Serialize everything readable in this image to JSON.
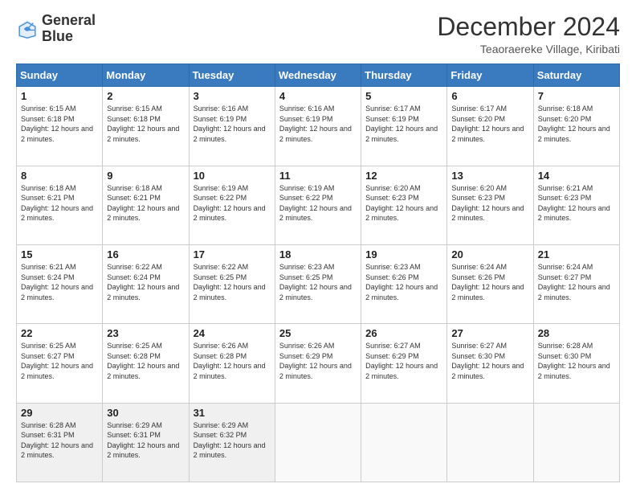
{
  "logo": {
    "line1": "General",
    "line2": "Blue"
  },
  "title": "December 2024",
  "subtitle": "Teaoraereke Village, Kiribati",
  "days_header": [
    "Sunday",
    "Monday",
    "Tuesday",
    "Wednesday",
    "Thursday",
    "Friday",
    "Saturday"
  ],
  "weeks": [
    [
      {
        "day": "1",
        "sunrise": "6:15 AM",
        "sunset": "6:18 PM",
        "daylight": "12 hours and 2 minutes."
      },
      {
        "day": "2",
        "sunrise": "6:15 AM",
        "sunset": "6:18 PM",
        "daylight": "12 hours and 2 minutes."
      },
      {
        "day": "3",
        "sunrise": "6:16 AM",
        "sunset": "6:19 PM",
        "daylight": "12 hours and 2 minutes."
      },
      {
        "day": "4",
        "sunrise": "6:16 AM",
        "sunset": "6:19 PM",
        "daylight": "12 hours and 2 minutes."
      },
      {
        "day": "5",
        "sunrise": "6:17 AM",
        "sunset": "6:19 PM",
        "daylight": "12 hours and 2 minutes."
      },
      {
        "day": "6",
        "sunrise": "6:17 AM",
        "sunset": "6:20 PM",
        "daylight": "12 hours and 2 minutes."
      },
      {
        "day": "7",
        "sunrise": "6:18 AM",
        "sunset": "6:20 PM",
        "daylight": "12 hours and 2 minutes."
      }
    ],
    [
      {
        "day": "8",
        "sunrise": "6:18 AM",
        "sunset": "6:21 PM",
        "daylight": "12 hours and 2 minutes."
      },
      {
        "day": "9",
        "sunrise": "6:18 AM",
        "sunset": "6:21 PM",
        "daylight": "12 hours and 2 minutes."
      },
      {
        "day": "10",
        "sunrise": "6:19 AM",
        "sunset": "6:22 PM",
        "daylight": "12 hours and 2 minutes."
      },
      {
        "day": "11",
        "sunrise": "6:19 AM",
        "sunset": "6:22 PM",
        "daylight": "12 hours and 2 minutes."
      },
      {
        "day": "12",
        "sunrise": "6:20 AM",
        "sunset": "6:23 PM",
        "daylight": "12 hours and 2 minutes."
      },
      {
        "day": "13",
        "sunrise": "6:20 AM",
        "sunset": "6:23 PM",
        "daylight": "12 hours and 2 minutes."
      },
      {
        "day": "14",
        "sunrise": "6:21 AM",
        "sunset": "6:23 PM",
        "daylight": "12 hours and 2 minutes."
      }
    ],
    [
      {
        "day": "15",
        "sunrise": "6:21 AM",
        "sunset": "6:24 PM",
        "daylight": "12 hours and 2 minutes."
      },
      {
        "day": "16",
        "sunrise": "6:22 AM",
        "sunset": "6:24 PM",
        "daylight": "12 hours and 2 minutes."
      },
      {
        "day": "17",
        "sunrise": "6:22 AM",
        "sunset": "6:25 PM",
        "daylight": "12 hours and 2 minutes."
      },
      {
        "day": "18",
        "sunrise": "6:23 AM",
        "sunset": "6:25 PM",
        "daylight": "12 hours and 2 minutes."
      },
      {
        "day": "19",
        "sunrise": "6:23 AM",
        "sunset": "6:26 PM",
        "daylight": "12 hours and 2 minutes."
      },
      {
        "day": "20",
        "sunrise": "6:24 AM",
        "sunset": "6:26 PM",
        "daylight": "12 hours and 2 minutes."
      },
      {
        "day": "21",
        "sunrise": "6:24 AM",
        "sunset": "6:27 PM",
        "daylight": "12 hours and 2 minutes."
      }
    ],
    [
      {
        "day": "22",
        "sunrise": "6:25 AM",
        "sunset": "6:27 PM",
        "daylight": "12 hours and 2 minutes."
      },
      {
        "day": "23",
        "sunrise": "6:25 AM",
        "sunset": "6:28 PM",
        "daylight": "12 hours and 2 minutes."
      },
      {
        "day": "24",
        "sunrise": "6:26 AM",
        "sunset": "6:28 PM",
        "daylight": "12 hours and 2 minutes."
      },
      {
        "day": "25",
        "sunrise": "6:26 AM",
        "sunset": "6:29 PM",
        "daylight": "12 hours and 2 minutes."
      },
      {
        "day": "26",
        "sunrise": "6:27 AM",
        "sunset": "6:29 PM",
        "daylight": "12 hours and 2 minutes."
      },
      {
        "day": "27",
        "sunrise": "6:27 AM",
        "sunset": "6:30 PM",
        "daylight": "12 hours and 2 minutes."
      },
      {
        "day": "28",
        "sunrise": "6:28 AM",
        "sunset": "6:30 PM",
        "daylight": "12 hours and 2 minutes."
      }
    ],
    [
      {
        "day": "29",
        "sunrise": "6:28 AM",
        "sunset": "6:31 PM",
        "daylight": "12 hours and 2 minutes."
      },
      {
        "day": "30",
        "sunrise": "6:29 AM",
        "sunset": "6:31 PM",
        "daylight": "12 hours and 2 minutes."
      },
      {
        "day": "31",
        "sunrise": "6:29 AM",
        "sunset": "6:32 PM",
        "daylight": "12 hours and 2 minutes."
      },
      null,
      null,
      null,
      null
    ]
  ]
}
